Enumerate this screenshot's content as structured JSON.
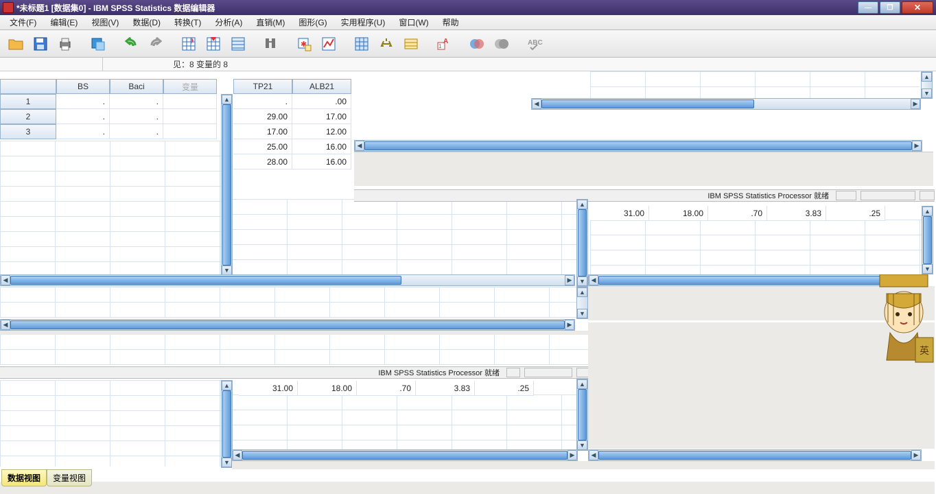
{
  "title": "*未标题1 [数据集0] - IBM SPSS Statistics 数据编辑器",
  "menu": {
    "file": "文件(F)",
    "edit": "编辑(E)",
    "view": "视图(V)",
    "data": "数据(D)",
    "transform": "转换(T)",
    "analyze": "分析(A)",
    "direct": "直销(M)",
    "graphs": "图形(G)",
    "util": "实用程序(U)",
    "window": "窗口(W)",
    "help": "帮助"
  },
  "info": {
    "varcount": "见：8 变量的 8"
  },
  "tabs": {
    "data": "数据视图",
    "var": "变量视图"
  },
  "status": "IBM SPSS Statistics Processor 就绪",
  "left_grid": {
    "cols": [
      "BS",
      "Baci"
    ],
    "var_placeholder": "变量",
    "rows": [
      "1",
      "2",
      "3"
    ],
    "cells": [
      [
        ".",
        "."
      ],
      [
        ".",
        "."
      ],
      [
        ".",
        "."
      ]
    ]
  },
  "mid_grid": {
    "cols": [
      "TP21",
      "ALB21"
    ],
    "rows": [
      [
        ".",
        ".00"
      ],
      [
        "29.00",
        "17.00"
      ],
      [
        "17.00",
        "12.00"
      ],
      [
        "25.00",
        "16.00"
      ],
      [
        "28.00",
        "16.00"
      ]
    ]
  },
  "row_right": {
    "values": [
      "31.00",
      "18.00",
      ".70",
      "3.83",
      ".25"
    ]
  },
  "row_mid2": {
    "values": [
      "31.00",
      "18.00",
      ".70",
      "3.83",
      ".25"
    ]
  }
}
